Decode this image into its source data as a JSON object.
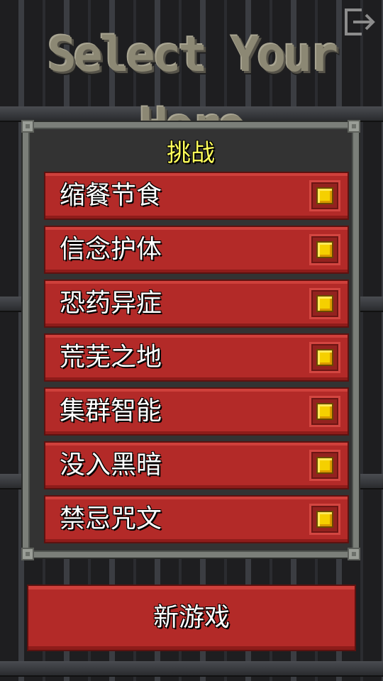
{
  "header": {
    "title": "Select Your Hero",
    "exit_icon": "exit-icon"
  },
  "challenges_panel": {
    "title": "挑战",
    "items": [
      {
        "label": "缩餐节食",
        "checked": true
      },
      {
        "label": "信念护体",
        "checked": true
      },
      {
        "label": "恐药异症",
        "checked": true
      },
      {
        "label": "荒芜之地",
        "checked": true
      },
      {
        "label": "集群智能",
        "checked": true
      },
      {
        "label": "没入黑暗",
        "checked": true
      },
      {
        "label": "禁忌咒文",
        "checked": true
      }
    ]
  },
  "footer": {
    "new_game_label": "新游戏"
  },
  "colors": {
    "button_red": "#b32a28",
    "panel_frame": "#7b7f79",
    "title_yellow": "#ffff5a",
    "check_gold": "#f5d000"
  }
}
